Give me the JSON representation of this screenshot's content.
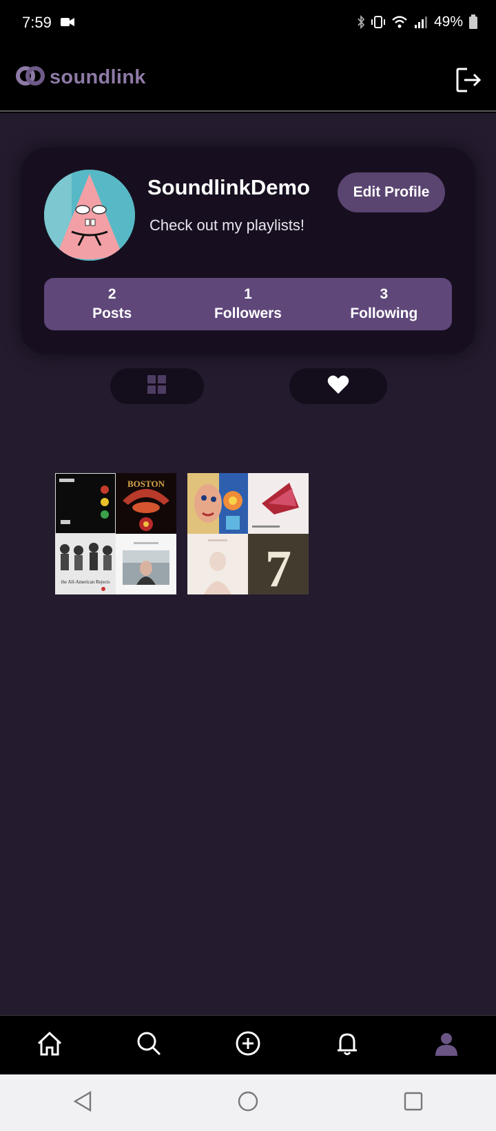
{
  "status_bar": {
    "time": "7:59",
    "battery": "49%"
  },
  "header": {
    "app_name": "soundlink",
    "logo_color": "#8e7aa6"
  },
  "profile": {
    "username": "SoundlinkDemo",
    "bio": "Check out my playlists!",
    "edit_button": "Edit Profile",
    "stats": [
      {
        "value": "2",
        "label": "Posts"
      },
      {
        "value": "1",
        "label": "Followers"
      },
      {
        "value": "3",
        "label": "Following"
      }
    ]
  },
  "tabs": [
    {
      "icon": "grid-icon",
      "selected": false
    },
    {
      "icon": "heart-icon",
      "selected": true
    }
  ],
  "playlists": [
    {
      "covers": [
        "band-traffic-lights-cover",
        "boston-spaceship-cover",
        "all-american-rejects-cover",
        "portrait-woman-cover"
      ],
      "cover_text": {
        "boston": "BOSTON",
        "rejects": "the All-American Rejects"
      }
    },
    {
      "covers": [
        "painted-face-cover",
        "red-abstract-cover",
        "pale-figure-cover",
        "number-seven-cover"
      ],
      "cover_text": {
        "seven": "7"
      }
    }
  ],
  "bottom_nav": [
    "home-icon",
    "search-icon",
    "add-icon",
    "notifications-icon",
    "profile-icon"
  ],
  "colors": {
    "background": "#241b2e",
    "card": "#170f1f",
    "accent": "#5f4779",
    "button": "#5a4470"
  }
}
